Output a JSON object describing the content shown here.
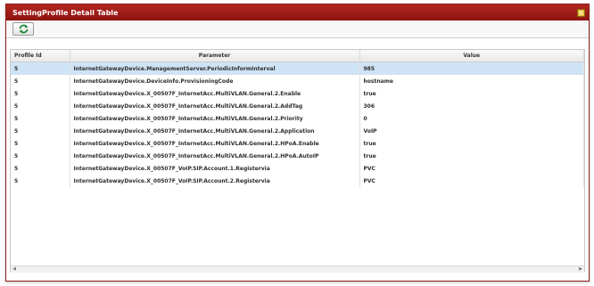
{
  "window": {
    "title": "SettingProfile Detail Table"
  },
  "toolbar": {
    "refresh_icon": "refresh-icon"
  },
  "table": {
    "headers": [
      "Profile Id",
      "Parameter",
      "Value"
    ],
    "rows": [
      [
        "5",
        "InternetGatewayDevice.ManagementServer.PeriodicInformInterval",
        "985"
      ],
      [
        "5",
        "InternetGatewayDevice.DeviceInfo.ProvisioningCode",
        "hostname"
      ],
      [
        "5",
        "InternetGatewayDevice.X_00507F_InternetAcc.MultiVLAN.General.2.Enable",
        "true"
      ],
      [
        "5",
        "InternetGatewayDevice.X_00507F_InternetAcc.MultiVLAN.General.2.AddTag",
        "306"
      ],
      [
        "5",
        "InternetGatewayDevice.X_00507F_InternetAcc.MultiVLAN.General.2.Priority",
        "0"
      ],
      [
        "5",
        "InternetGatewayDevice.X_00507F_InternetAcc.MultiVLAN.General.2.Application",
        "VoIP"
      ],
      [
        "5",
        "InternetGatewayDevice.X_00507F_InternetAcc.MultiVLAN.General.2.HPoA.Enable",
        "true"
      ],
      [
        "5",
        "InternetGatewayDevice.X_00507F_InternetAcc.MultiVLAN.General.2.HPoA.AutoIP",
        "true"
      ],
      [
        "5",
        "InternetGatewayDevice.X_00507F_VoIP.SIP.Account.1.Registervia",
        "PVC"
      ],
      [
        "5",
        "InternetGatewayDevice.X_00507F_VoIP.SIP.Account.2.Registervia",
        "PVC"
      ]
    ]
  }
}
